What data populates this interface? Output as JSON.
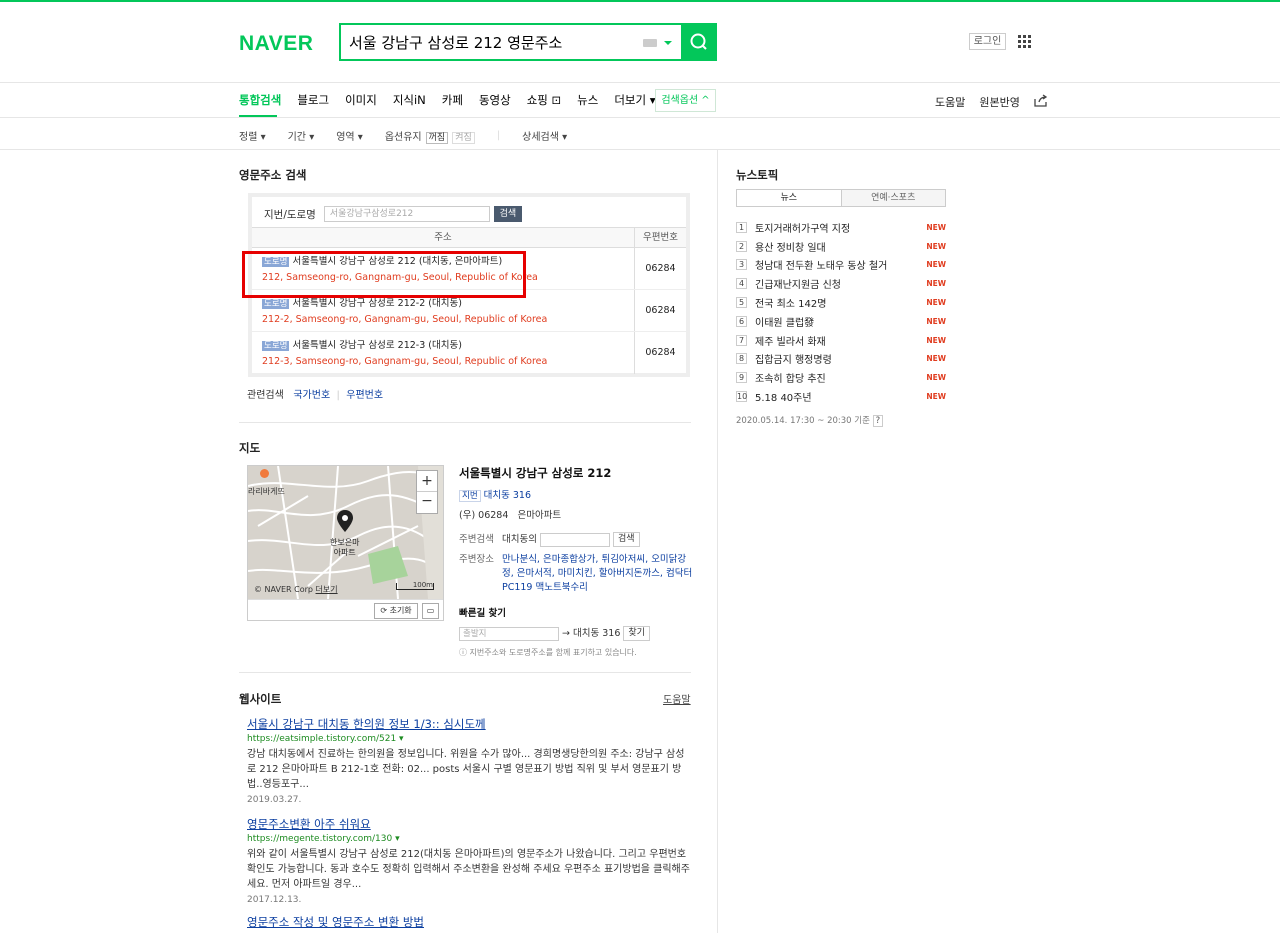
{
  "header": {
    "logo": "NAVER",
    "query": "서울 강남구 삼성로 212 영문주소",
    "login": "로그인"
  },
  "tabs": [
    {
      "label": "통합검색",
      "active": true
    },
    {
      "label": "블로그"
    },
    {
      "label": "이미지"
    },
    {
      "label": "지식iN"
    },
    {
      "label": "카페"
    },
    {
      "label": "동영상"
    },
    {
      "label": "쇼핑 ⊡"
    },
    {
      "label": "뉴스"
    },
    {
      "label": "더보기 ▾"
    }
  ],
  "search_options": "검색옵션 ^",
  "right_nav": {
    "help": "도움말",
    "original": "원본반영"
  },
  "filters": {
    "sort": "정렬 ▾",
    "period": "기간 ▾",
    "area": "영역 ▾",
    "option_keep": "옵션유지",
    "on": "꺼짐",
    "off": "켜짐",
    "detail": "상세검색 ▾"
  },
  "address": {
    "section_title": "영문주소 검색",
    "form_label": "지번/도로명",
    "input_placeholder": "서울강남구삼성로212",
    "search_btn": "검색",
    "col_addr": "주소",
    "col_zip": "우편번호",
    "badge": "도로명",
    "rows": [
      {
        "kr": "서울특별시 강남구 삼성로 212 (대치동, 은마아파트)",
        "en": "212, Samseong-ro, Gangnam-gu, Seoul, Republic of Korea",
        "zip": "06284"
      },
      {
        "kr": "서울특별시 강남구 삼성로 212-2 (대치동)",
        "en": "212-2, Samseong-ro, Gangnam-gu, Seoul, Republic of Korea",
        "zip": "06284"
      },
      {
        "kr": "서울특별시 강남구 삼성로 212-3 (대치동)",
        "en": "212-3, Samseong-ro, Gangnam-gu, Seoul, Republic of Korea",
        "zip": "06284"
      }
    ],
    "related_label": "관련검색",
    "related_1": "국가번호",
    "related_2": "우편번호"
  },
  "map": {
    "section_title": "지도",
    "poi_1": "라리바게뜨",
    "poi_2": "한보은마\n아파트",
    "copyright": "© NAVER Corp",
    "more": "더보기",
    "scale": "100m",
    "reset": "초기화",
    "title": "서울특별시 강남구 삼성로 212",
    "jibun_badge": "지번",
    "jibun": "대치동 316",
    "zip_line": "(우) 06284",
    "building": "은마아파트",
    "nearby_search_label": "주변검색",
    "nearby_search_value": "대치동의",
    "nearby_btn": "검색",
    "nearby_place_label": "주변장소",
    "nearby_places": "만나분식, 은마종합상가, 튀김아저씨, 오미닭강정, 은마서적, 마미치킨, 할아버지돈까스, 컴닥터PC119 맥노트북수리",
    "route_title": "빠른길 찾기",
    "route_from": "출발지",
    "route_to": "대치동 316",
    "route_btn": "찾기",
    "note": "지번주소와 도로명주소를 함께 표기하고 있습니다."
  },
  "web": {
    "section_title": "웹사이트",
    "help": "도움말",
    "items": [
      {
        "title": "서울시 강남구 대치동 한의원 정보 1/3:: 심시도께",
        "url": "https://eatsimple.tistory.com/521 ▾",
        "desc": "강남 대치동에서 진료하는 한의원을 정보입니다. 위원을 수가 많아... 경희명생당한의원 주소: 강남구 삼성로 212 은마아파트 B 212-1호 전화: 02... posts 서울시 구별 영문표기 방법 직위 및 부서 영문표기 방법..영등포구...",
        "date": "2019.03.27."
      },
      {
        "title": "영문주소변환 아주 쉬워요",
        "url": "https://megente.tistory.com/130 ▾",
        "desc": "위와 같이 서울특별시 강남구 삼성로 212(대치동 은마아파트)의 영문주소가 나왔습니다. 그리고 우편번호 확인도 가능합니다. 동과 호수도 정확히 입력해서 주소변환을 완성해 주세요 우편주소 표기방법을 클릭해주세요. 먼저 아파트일 경우...",
        "date": "2017.12.13."
      },
      {
        "title": "영문주소 작성 및 영문주소 변환 방법"
      }
    ]
  },
  "news": {
    "title": "뉴스토픽",
    "tab_news": "뉴스",
    "tab_ent": "연예·스포츠",
    "items": [
      {
        "rank": "1",
        "text": "토지거래허가구역 지정",
        "badge": "NEW"
      },
      {
        "rank": "2",
        "text": "용산 정비창 일대",
        "badge": "NEW"
      },
      {
        "rank": "3",
        "text": "청남대 전두환 노태우 동상 철거",
        "badge": "NEW"
      },
      {
        "rank": "4",
        "text": "긴급재난지원금 신청",
        "badge": "NEW"
      },
      {
        "rank": "5",
        "text": "전국 최소 142명",
        "badge": "NEW"
      },
      {
        "rank": "6",
        "text": "이태원 클럽發",
        "badge": "NEW"
      },
      {
        "rank": "7",
        "text": "제주 빌라서 화재",
        "badge": "NEW"
      },
      {
        "rank": "8",
        "text": "집합금지 행정명령",
        "badge": "NEW"
      },
      {
        "rank": "9",
        "text": "조속히 합당 추진",
        "badge": "NEW"
      },
      {
        "rank": "10",
        "text": "5.18 40주년",
        "badge": "NEW"
      }
    ],
    "footer": "2020.05.14. 17:30 ~ 20:30 기준"
  }
}
